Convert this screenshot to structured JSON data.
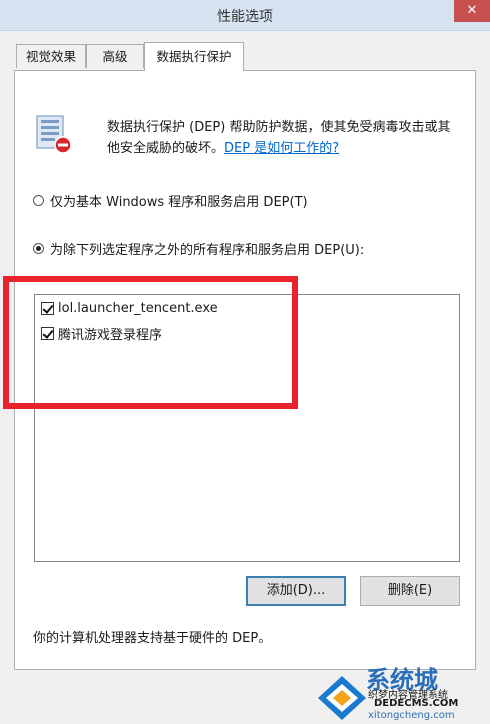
{
  "window": {
    "title": "性能选项",
    "close": "✕"
  },
  "tabs": [
    {
      "label": "视觉效果"
    },
    {
      "label": "高级"
    },
    {
      "label": "数据执行保护"
    }
  ],
  "dep": {
    "icon": "dep-shield-icon",
    "description": "数据执行保护 (DEP) 帮助防护数据，使其免受病毒攻击或其他安全威胁的破坏。",
    "link": "DEP 是如何工作的?",
    "option1": "仅为基本 Windows 程序和服务启用 DEP(T)",
    "option2": "为除下列选定程序之外的所有程序和服务启用 DEP(U):",
    "selected_option": 2
  },
  "program_list": [
    {
      "label": "lol.launcher_tencent.exe",
      "checked": true
    },
    {
      "label": "腾讯游戏登录程序",
      "checked": true
    }
  ],
  "buttons": {
    "add": "添加(D)...",
    "remove": "删除(E)"
  },
  "footer": "你的计算机处理器支持基于硬件的 DEP。",
  "watermark": {
    "brand": "系统城",
    "subtitle": "织梦内容管理系统",
    "domain": "DEDECMS.COM",
    "url": "xitongcheng.com"
  },
  "colors": {
    "highlight_rect": "#e8232c",
    "link": "#0066cc",
    "titlebar": "#d6e4f2"
  }
}
